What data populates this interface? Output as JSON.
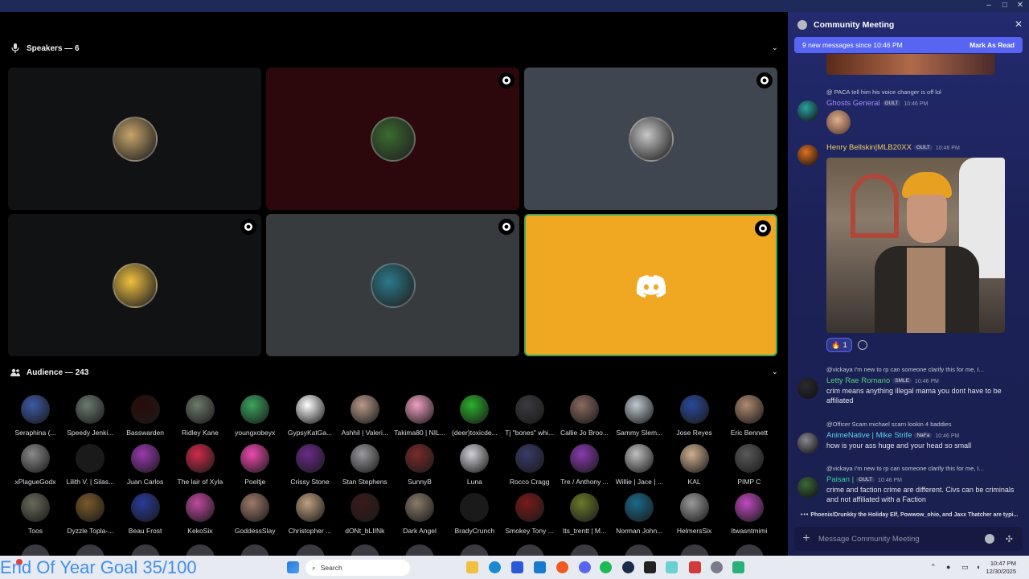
{
  "window": {
    "controls": [
      "–",
      "□",
      "✕"
    ]
  },
  "stage": {
    "speakers_header": "Speakers — 6",
    "audience_header": "Audience — 243",
    "speakers": [
      {
        "bg": "#111214",
        "avatar": "#c8a56a",
        "badge": false
      },
      {
        "bg": "#2c070b",
        "avatar": "#3a6b2e",
        "badge": true
      },
      {
        "bg": "#40464f",
        "avatar": "#c7c7c7",
        "badge": true
      },
      {
        "bg": "#111214",
        "avatar": "#f0c040",
        "badge": true
      },
      {
        "bg": "#383b3e",
        "avatar": "#2a7a8a",
        "badge": true
      },
      {
        "bg": "#f0a823",
        "avatar": "discord",
        "badge": true,
        "outline": "#3ba55d"
      }
    ],
    "audience": [
      {
        "name": "Seraphina (...",
        "color": "#3c5aa6"
      },
      {
        "name": "Speedy Jenki...",
        "color": "#6b7a70"
      },
      {
        "name": "Basswarden",
        "color": "#2a0a0a"
      },
      {
        "name": "Ridley Kane",
        "color": "#6e7a6a"
      },
      {
        "name": "youngxobeyx",
        "color": "#3ba55d"
      },
      {
        "name": "GypsyKatGa...",
        "color": "#ffffff"
      },
      {
        "name": "Ashhil | Valeri...",
        "color": "#b89a8a"
      },
      {
        "name": "Takima80 | NIL...",
        "color": "#f0a0c0"
      },
      {
        "name": "(deer)toxicde...",
        "color": "#2bb02b"
      },
      {
        "name": "Tj \"bones\" whi...",
        "color": "#3a3a40"
      },
      {
        "name": "Callie Jo Broo...",
        "color": "#8a6a60"
      },
      {
        "name": "Sammy Slem...",
        "color": "#c0c8d0"
      },
      {
        "name": "Jose Reyes",
        "color": "#2a4a9a"
      },
      {
        "name": "Eric Bennett",
        "color": "#b08a70"
      },
      {
        "name": "xPlagueGodx",
        "color": "#8a8a8a"
      },
      {
        "name": "Lilith V. | Silas...",
        "color": "#1a1a1a"
      },
      {
        "name": "Juan Carlos",
        "color": "#9a3ab0"
      },
      {
        "name": "The lair of Xyla",
        "color": "#d02a4a"
      },
      {
        "name": "Poeltje",
        "color": "#f04ab0"
      },
      {
        "name": "Crissy Stone",
        "color": "#6a2a8a"
      },
      {
        "name": "Stan Stephens",
        "color": "#9a9aa0"
      },
      {
        "name": "SunnyB",
        "color": "#7a2a2a"
      },
      {
        "name": "Luna",
        "color": "#d0d0d8"
      },
      {
        "name": "Rocco Cragg",
        "color": "#3a3a6a"
      },
      {
        "name": "Tre / Anthony ...",
        "color": "#8a3ab0"
      },
      {
        "name": "Willie | Jace | ...",
        "color": "#c0c0c0"
      },
      {
        "name": "KAL",
        "color": "#d0b090"
      },
      {
        "name": "PIMP C",
        "color": "#5a5a5a"
      },
      {
        "name": "Toos",
        "color": "#6a6a5a"
      },
      {
        "name": "Dyzzle Topla-...",
        "color": "#7a5a2a"
      },
      {
        "name": "Beau Frost",
        "color": "#2a3a9a"
      },
      {
        "name": "KekoSix",
        "color": "#c04aa0"
      },
      {
        "name": "GoddessSlay",
        "color": "#a07a6a"
      },
      {
        "name": "Christopher ...",
        "color": "#c0a080"
      },
      {
        "name": "dONt_bLIINk",
        "color": "#3a1a1a"
      },
      {
        "name": "Dark Angel",
        "color": "#8a7a6a"
      },
      {
        "name": "BradyCrunch",
        "color": "#1a1a1a"
      },
      {
        "name": "Smokey Tony ...",
        "color": "#7a1a1a"
      },
      {
        "name": "Its_trentt | M...",
        "color": "#6a7a2a"
      },
      {
        "name": "Norman John...",
        "color": "#1a6a8a"
      },
      {
        "name": "HelmersSix",
        "color": "#9a9a9a"
      },
      {
        "name": "Itwasntmimi",
        "color": "#c04ac0"
      }
    ]
  },
  "goal_text": "End Of Year Goal 35/100",
  "chat": {
    "title": "Community Meeting",
    "new_messages": "9 new messages since 10:46 PM",
    "mark_read": "Mark As Read",
    "messages": [
      {
        "reply": "@ PACA  tell him his voice changer is off lol",
        "author": "Ghosts General",
        "author_color": "#a48cff",
        "tag": "GULT",
        "time": "10:46 PM",
        "body": "",
        "pfp": "#2aa0a0"
      },
      {
        "reply": "",
        "author": "Henry Bellskin|MLB20XX",
        "author_color": "#f0d060",
        "tag": "GULT",
        "time": "10:46 PM",
        "body": "",
        "pfp": "#e07020"
      },
      {
        "reply": "@vickaya I'm new to rp can someone clarify this for me, I...",
        "author": "Letty Rae Romano",
        "author_color": "#5ad07a",
        "tag": "SMLE",
        "time": "10:46 PM",
        "body": "crim means anything illegal mama you dont have to be affiliated",
        "pfp": "#2a2a30"
      },
      {
        "reply": "@Officer Scam  michael scarn lookin 4 baddies",
        "author": "AnimeNative | Mike Strife",
        "author_color": "#5ad0f0",
        "tag": "NaFa",
        "time": "10:46 PM",
        "body": "how is your ass huge and your head so small",
        "pfp": "#888890"
      },
      {
        "reply": "@vickaya I'm new to rp can someone clarify this for me, I...",
        "author": "Paisan |",
        "author_color": "#3ad0a0",
        "tag": "GULT",
        "time": "10:46 PM",
        "body": "crime and faction crime are different. Civs can be criminals and not affiliated with a Faction",
        "pfp": "#3a6a3a"
      }
    ],
    "reaction_count": "1",
    "typing": "Phoenix/Drunkky the Holiday Elf, Powwow_ohio, and Jaxx Thatcher are typi...",
    "placeholder": "Message Community Meeting"
  },
  "taskbar": {
    "search_label": "Search",
    "time": "10:47 PM",
    "date": "12/30/2025"
  }
}
